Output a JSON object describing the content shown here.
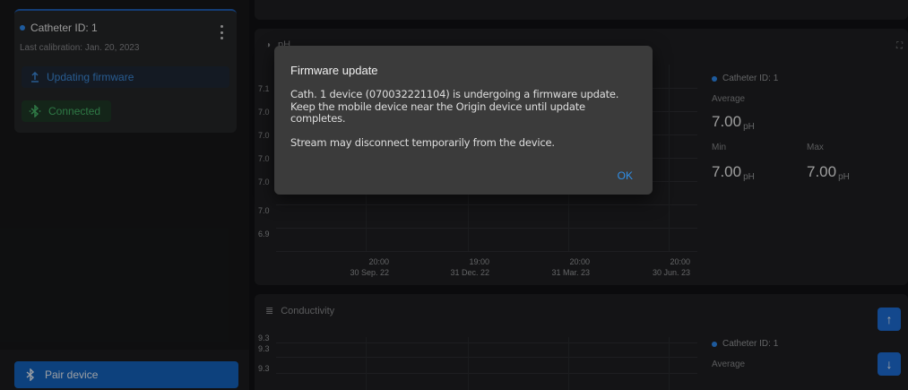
{
  "sidebar": {
    "catheter": {
      "title": "Catheter ID: 1",
      "calibration": "Last calibration: Jan. 20, 2023",
      "firmware_status": "Updating firmware",
      "connection_status": "Connected"
    },
    "pair_button": "Pair device"
  },
  "ph_panel": {
    "title": "pH",
    "y_ticks": [
      "7.1",
      "7.0",
      "7.0",
      "7.0",
      "7.0",
      "7.0",
      "6.9"
    ],
    "x_ticks": [
      {
        "time": "20:00",
        "date": "30 Sep. 22"
      },
      {
        "time": "19:00",
        "date": "31 Dec. 22"
      },
      {
        "time": "20:00",
        "date": "31 Mar. 23"
      },
      {
        "time": "20:00",
        "date": "30 Jun. 23"
      }
    ],
    "stats": {
      "catheter": "Catheter ID: 1",
      "average_label": "Average",
      "average_value": "7.00",
      "min_label": "Min",
      "min_value": "7.00",
      "max_label": "Max",
      "max_value": "7.00",
      "unit": "pH"
    }
  },
  "conductivity_panel": {
    "title": "Conductivity",
    "y_ticks": [
      "9.3",
      "9.3",
      "9.3"
    ],
    "stats": {
      "catheter": "Catheter ID: 1",
      "average_label": "Average"
    }
  },
  "dialog": {
    "title": "Firmware update",
    "body_1": "Cath. 1 device (070032221104) is undergoing a firmware update. Keep the mobile device near the Origin device until update completes.",
    "body_2": "Stream may disconnect temporarily from the device.",
    "ok_label": "OK"
  },
  "colors": {
    "accent": "#1565c0",
    "link": "#2f8fe8",
    "connected": "#47b86a"
  },
  "icons": {
    "upload": "upload-icon",
    "bluetooth": "bluetooth-icon"
  }
}
